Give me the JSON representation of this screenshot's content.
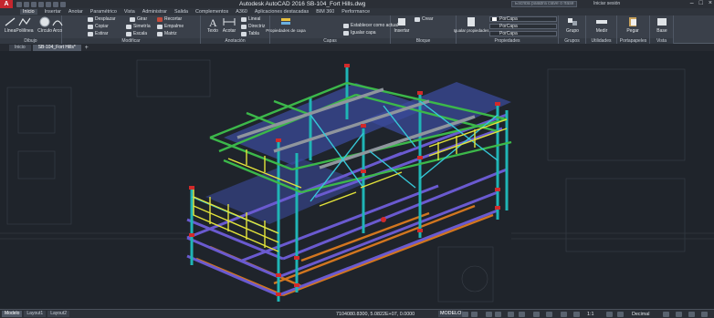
{
  "app": {
    "title": "Autodesk AutoCAD 2016    SB-104_Fort Hills.dwg",
    "logo_letter": "A",
    "search_placeholder": "Escriba palabra clave o frase",
    "login_label": "Iniciar sesión"
  },
  "ribbon_tabs": [
    "Inicio",
    "Insertar",
    "Anotar",
    "Paramétrico",
    "Vista",
    "Administrar",
    "Salida",
    "Complementos",
    "A360",
    "Aplicaciones destacadas",
    "BIM 360",
    "Performance"
  ],
  "ribbon": {
    "dibujo": {
      "label": "Dibujo",
      "tools": [
        "Línea",
        "Polilínea",
        "Círculo",
        "Arco"
      ]
    },
    "modificar": {
      "label": "Modificar",
      "tools": [
        "Desplazar",
        "Girar",
        "Recortar",
        "Copiar",
        "Simetría",
        "Empalme",
        "Estirar",
        "Escala",
        "Matriz"
      ]
    },
    "anotacion": {
      "label": "Anotación",
      "tools": [
        "Texto",
        "Acotar",
        "Lineal",
        "Directriz",
        "Tabla"
      ]
    },
    "capas": {
      "label": "Capas",
      "tools": [
        "Propiedades de capa",
        "Establecer como actual",
        "Igualar capa"
      ]
    },
    "bloque": {
      "label": "Bloque",
      "tools": [
        "Insertar",
        "Crear"
      ]
    },
    "propiedades": {
      "label": "Propiedades",
      "tools": [
        "Igualar propiedades"
      ],
      "selects": [
        "PorCapa",
        "PorCapa",
        "PorCapa"
      ]
    },
    "grupos": {
      "label": "Grupos",
      "tools": [
        "Grupo"
      ]
    },
    "utilidades": {
      "label": "Utilidades",
      "tools": [
        "Medir"
      ]
    },
    "portapapeles": {
      "label": "Portapapeles",
      "tools": [
        "Pegar"
      ]
    },
    "vista": {
      "label": "Vista",
      "tools": [
        "Base"
      ]
    }
  },
  "doc_tabs": [
    "Inicio",
    "SB-104_Fort Hills*"
  ],
  "layout_tabs": [
    "Modelo",
    "Layout1",
    "Layout2"
  ],
  "status": {
    "coords": "7104080.8300, 5.0822E+07, 0.0000",
    "model_label": "MODELO",
    "scale": "1:1",
    "units": "Decimal"
  },
  "colors": {
    "background": "#1f242b",
    "beam_top": "#3cb84a",
    "column": "#1fb5b5",
    "beam_mid": "#6a5ad0",
    "beam_low": "#d2761f",
    "railing": "#e3e33a",
    "grating": "#3b4a9a",
    "accent_red": "#d22a2a"
  },
  "icons": [
    "line-icon",
    "polyline-icon",
    "circle-icon",
    "arc-icon",
    "move-icon",
    "rotate-icon",
    "text-icon",
    "dimension-icon",
    "layer-icon",
    "insert-block-icon",
    "group-icon",
    "measure-icon",
    "paste-icon",
    "base-icon"
  ]
}
